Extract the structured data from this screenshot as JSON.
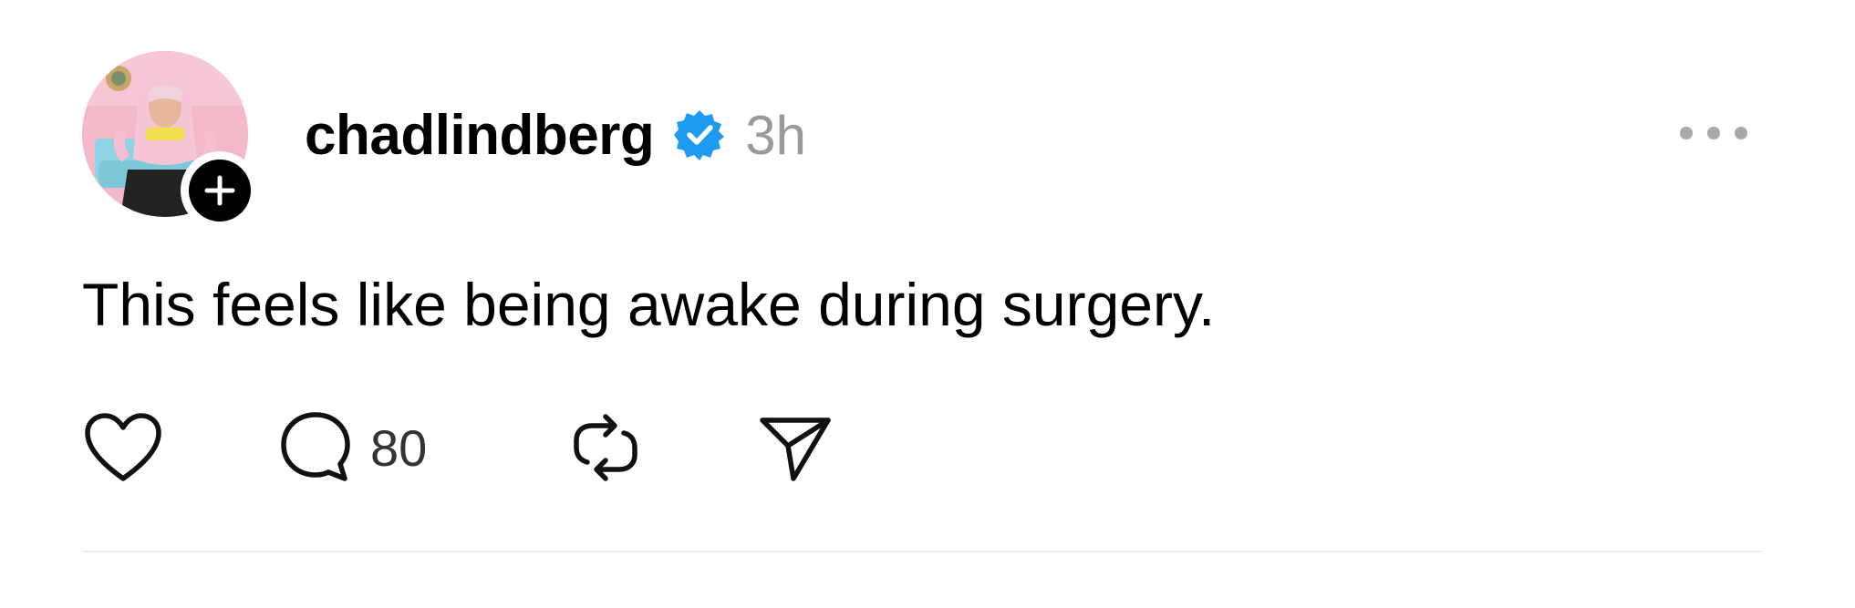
{
  "post": {
    "author": {
      "username": "chadlindberg",
      "verified": true,
      "avatar_icon": "profile-photo",
      "follow_icon": "plus-icon"
    },
    "time": "3h",
    "more_icon": "more-icon",
    "text": "This feels like being awake during surgery.",
    "actions": {
      "like_icon": "heart-icon",
      "reply_icon": "comment-icon",
      "reply_count": "80",
      "repost_icon": "repost-icon",
      "share_icon": "send-icon"
    }
  },
  "colors": {
    "text": "#000000",
    "muted": "#9a9a9a",
    "verified": "#1d9bf0",
    "divider": "#ececec"
  }
}
